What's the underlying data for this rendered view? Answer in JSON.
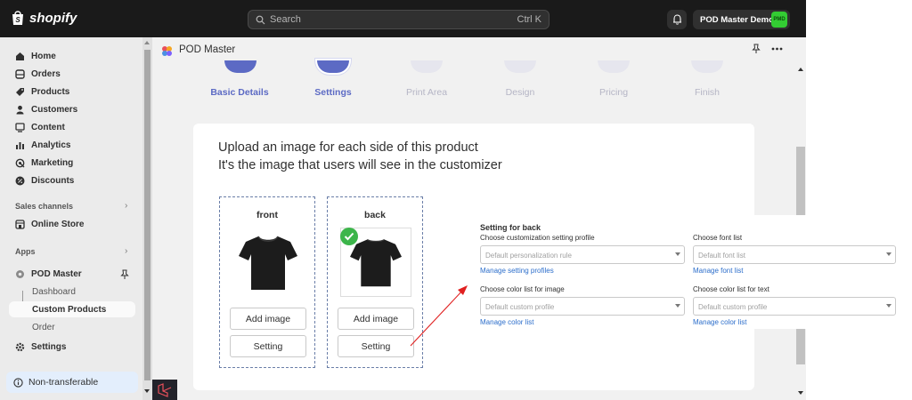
{
  "topbar": {
    "logo_text": "shopify",
    "search_placeholder": "Search",
    "search_shortcut": "Ctrl K",
    "store_name": "POD Master Demo",
    "avatar_text": "PMD"
  },
  "sidebar": {
    "items": [
      {
        "label": "Home",
        "icon": "home-icon"
      },
      {
        "label": "Orders",
        "icon": "orders-icon"
      },
      {
        "label": "Products",
        "icon": "products-icon"
      },
      {
        "label": "Customers",
        "icon": "customers-icon"
      },
      {
        "label": "Content",
        "icon": "content-icon"
      },
      {
        "label": "Analytics",
        "icon": "analytics-icon"
      },
      {
        "label": "Marketing",
        "icon": "marketing-icon"
      },
      {
        "label": "Discounts",
        "icon": "discounts-icon"
      }
    ],
    "sales_channels_label": "Sales channels",
    "online_store_label": "Online Store",
    "apps_label": "Apps",
    "pod_master_label": "POD Master",
    "sub_items": [
      "Dashboard",
      "Custom Products",
      "Order"
    ],
    "settings_label": "Settings",
    "non_transferable_label": "Non-transferable"
  },
  "app_header": {
    "title": "POD Master"
  },
  "steps": [
    {
      "label": "Basic Details",
      "state": "complete"
    },
    {
      "label": "Settings",
      "state": "active"
    },
    {
      "label": "Print Area",
      "state": "pending"
    },
    {
      "label": "Design",
      "state": "pending"
    },
    {
      "label": "Pricing",
      "state": "pending"
    },
    {
      "label": "Finish",
      "state": "pending"
    }
  ],
  "upload": {
    "line1": "Upload an image for each side of this product",
    "line2": "It's the image that users will see in the customizer",
    "sides": [
      {
        "name": "front",
        "add_label": "Add image",
        "setting_label": "Setting",
        "selected": false
      },
      {
        "name": "back",
        "add_label": "Add image",
        "setting_label": "Setting",
        "selected": true
      }
    ]
  },
  "setting_panel": {
    "title": "Setting for back",
    "profile_label": "Choose customization setting profile",
    "profile_value": "Default personalization rule",
    "profile_link": "Manage setting profiles",
    "font_label": "Choose font list",
    "font_value": "Default font list",
    "font_link": "Manage font list",
    "color_image_label": "Choose color list for image",
    "color_image_value": "Default custom profile",
    "color_image_link": "Manage color list",
    "color_text_label": "Choose color list for text",
    "color_text_value": "Default custom profile",
    "color_text_link": "Manage color list"
  },
  "colors": {
    "accent": "#5c6ac4",
    "link": "#2c6ecb",
    "topbar": "#1a1a1a",
    "sidebar": "#ebebeb",
    "check": "#3cb54a",
    "arrow": "#e02020"
  }
}
